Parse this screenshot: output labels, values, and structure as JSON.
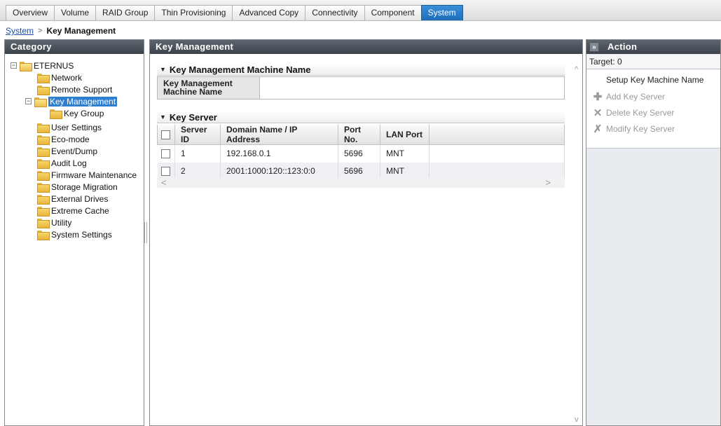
{
  "tabs": [
    "Overview",
    "Volume",
    "RAID Group",
    "Thin Provisioning",
    "Advanced Copy",
    "Connectivity",
    "Component",
    "System"
  ],
  "active_tab": "System",
  "breadcrumb": {
    "link": "System",
    "separator": ">",
    "current": "Key Management"
  },
  "category": {
    "title": "Category",
    "tree": [
      {
        "label": "ETERNUS",
        "level": 0
      },
      {
        "label": "Network",
        "level": 1
      },
      {
        "label": "Remote Support",
        "level": 1
      },
      {
        "label": "Key Management",
        "level": 1
      },
      {
        "label": "Key Group",
        "level": 2
      },
      {
        "label": "User Settings",
        "level": 1
      },
      {
        "label": "Eco-mode",
        "level": 1
      },
      {
        "label": "Event/Dump",
        "level": 1
      },
      {
        "label": "Audit Log",
        "level": 1
      },
      {
        "label": "Firmware Maintenance",
        "level": 1
      },
      {
        "label": "Storage Migration",
        "level": 1
      },
      {
        "label": "External Drives",
        "level": 1
      },
      {
        "label": "Extreme Cache",
        "level": 1
      },
      {
        "label": "Utility",
        "level": 1
      },
      {
        "label": "System Settings",
        "level": 1
      }
    ],
    "selected": "Key Management"
  },
  "main": {
    "title": "Key Management",
    "machine_section": {
      "title": "Key Management Machine Name",
      "label_line1": "Key Management",
      "label_line2": "Machine Name",
      "value": ""
    },
    "server_section": {
      "title": "Key Server",
      "columns": [
        "Server ID",
        "Domain Name / IP Address",
        "Port No.",
        "LAN Port"
      ],
      "rows": [
        {
          "server_id": "1",
          "address": "192.168.0.1",
          "port": "5696",
          "lan_port": "MNT"
        },
        {
          "server_id": "2",
          "address": "2001:1000:120::123:0:0",
          "port": "5696",
          "lan_port": "MNT"
        }
      ]
    }
  },
  "action": {
    "title": "Action",
    "collapse_glyph": "»",
    "target": "Target: 0",
    "items": [
      {
        "label": "Setup Key Machine Name",
        "enabled": true,
        "icon": "none"
      },
      {
        "label": "Add Key Server",
        "enabled": false,
        "icon": "plus-icon"
      },
      {
        "label": "Delete Key Server",
        "enabled": false,
        "icon": "x-icon"
      },
      {
        "label": "Modify Key Server",
        "enabled": false,
        "icon": "modify-icon"
      }
    ]
  },
  "glyphs": {
    "expand_minus": "−",
    "triangle_down": "▼",
    "scroll_left": "<",
    "scroll_right": ">",
    "scroll_up": "^",
    "scroll_down": "v"
  }
}
